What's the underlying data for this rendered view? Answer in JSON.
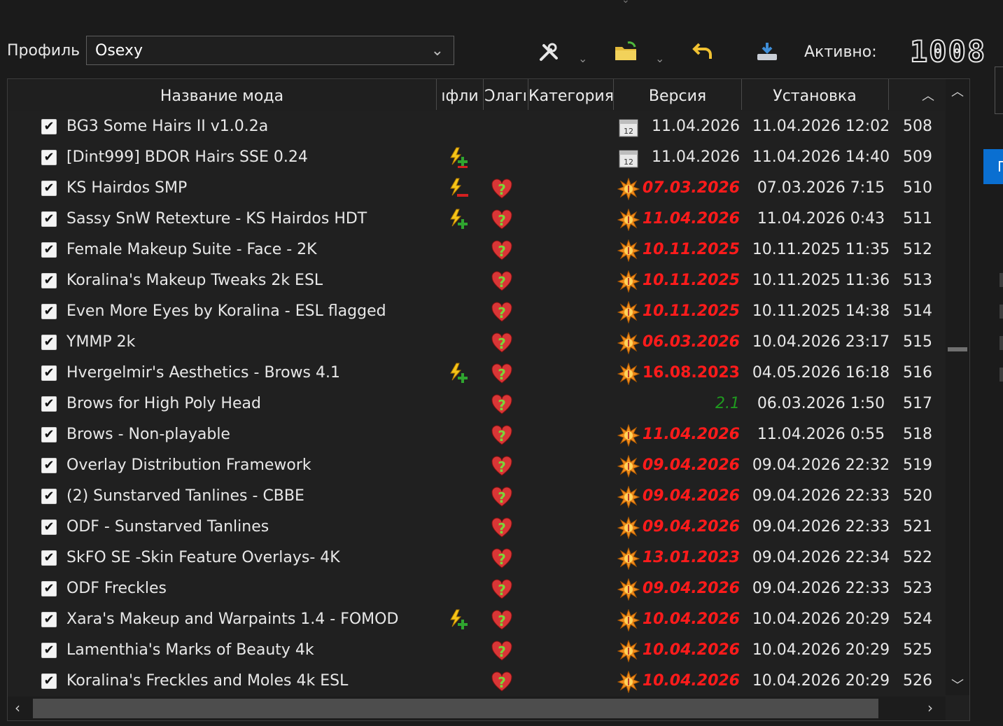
{
  "profile": {
    "label": "Профиль",
    "value": "Osexy"
  },
  "toolbar": {
    "active_label": "Активно:",
    "active_count": "1008"
  },
  "right_panel": {
    "tab_fragment": "П"
  },
  "columns": [
    "Название мода",
    "ıфли",
    "Ͻлагı",
    "Категория",
    "Версия",
    "Установка"
  ],
  "mods": [
    {
      "name": "BG3 Some Hairs II v1.0.2a",
      "conflict": "",
      "flag": "",
      "ver_icon": "calendar",
      "version": "11.04.2026",
      "version_style": "plain",
      "installed": "11.04.2026 12:02",
      "priority": "508"
    },
    {
      "name": "[Dint999] BDOR Hairs SSE 0.24",
      "conflict": "overwrite-both",
      "flag": "",
      "ver_icon": "calendar",
      "version": "11.04.2026",
      "version_style": "plain",
      "installed": "11.04.2026 14:40",
      "priority": "509"
    },
    {
      "name": "KS Hairdos SMP",
      "conflict": "overwritten",
      "flag": "heart-question",
      "ver_icon": "burst",
      "version": "07.03.2026",
      "version_style": "red",
      "installed": "07.03.2026 7:15",
      "priority": "510"
    },
    {
      "name": "Sassy SnW Retexture - KS Hairdos HDT",
      "conflict": "overwrites",
      "flag": "heart-question",
      "ver_icon": "burst",
      "version": "11.04.2026",
      "version_style": "red",
      "installed": "11.04.2026 0:43",
      "priority": "511"
    },
    {
      "name": "Female Makeup Suite - Face - 2K",
      "conflict": "",
      "flag": "heart-question",
      "ver_icon": "burst",
      "version": "10.11.2025",
      "version_style": "red",
      "installed": "10.11.2025 11:35",
      "priority": "512"
    },
    {
      "name": "Koralina's Makeup Tweaks 2k ESL",
      "conflict": "",
      "flag": "heart-question",
      "ver_icon": "burst",
      "version": "10.11.2025",
      "version_style": "red",
      "installed": "10.11.2025 11:36",
      "priority": "513"
    },
    {
      "name": "Even More Eyes by Koralina - ESL flagged",
      "conflict": "",
      "flag": "heart-question",
      "ver_icon": "burst",
      "version": "10.11.2025",
      "version_style": "red",
      "installed": "10.11.2025 14:38",
      "priority": "514"
    },
    {
      "name": "YMMP 2k",
      "conflict": "",
      "flag": "heart-question",
      "ver_icon": "burst",
      "version": "06.03.2026",
      "version_style": "red",
      "installed": "10.04.2026 23:17",
      "priority": "515"
    },
    {
      "name": "Hvergelmir's Aesthetics - Brows 4.1",
      "conflict": "overwrites",
      "flag": "heart-question",
      "ver_icon": "burst",
      "version": "16.08.2023",
      "version_style": "red-upright",
      "installed": "04.05.2026 16:18",
      "priority": "516"
    },
    {
      "name": "Brows for High Poly Head",
      "conflict": "",
      "flag": "heart-question",
      "ver_icon": "",
      "version": "2.1",
      "version_style": "green",
      "installed": "06.03.2026 1:50",
      "priority": "517"
    },
    {
      "name": "Brows - Non-playable",
      "conflict": "",
      "flag": "heart-question",
      "ver_icon": "burst",
      "version": "11.04.2026",
      "version_style": "red",
      "installed": "11.04.2026 0:55",
      "priority": "518"
    },
    {
      "name": "Overlay Distribution Framework",
      "conflict": "",
      "flag": "heart-question",
      "ver_icon": "burst",
      "version": "09.04.2026",
      "version_style": "red",
      "installed": "09.04.2026 22:32",
      "priority": "519"
    },
    {
      "name": "(2) Sunstarved Tanlines - CBBE",
      "conflict": "",
      "flag": "heart-question",
      "ver_icon": "burst",
      "version": "09.04.2026",
      "version_style": "red",
      "installed": "09.04.2026 22:33",
      "priority": "520"
    },
    {
      "name": "ODF - Sunstarved Tanlines",
      "conflict": "",
      "flag": "heart-question",
      "ver_icon": "burst",
      "version": "09.04.2026",
      "version_style": "red",
      "installed": "09.04.2026 22:33",
      "priority": "521"
    },
    {
      "name": "SkFO SE -Skin Feature Overlays- 4K",
      "conflict": "",
      "flag": "heart-question",
      "ver_icon": "burst",
      "version": "13.01.2023",
      "version_style": "red",
      "installed": "09.04.2026 22:34",
      "priority": "522"
    },
    {
      "name": "ODF Freckles",
      "conflict": "",
      "flag": "heart-question",
      "ver_icon": "burst",
      "version": "09.04.2026",
      "version_style": "red",
      "installed": "09.04.2026 22:33",
      "priority": "523"
    },
    {
      "name": "Xara's Makeup and Warpaints 1.4 - FOMOD",
      "conflict": "overwrites",
      "flag": "heart-question",
      "ver_icon": "burst",
      "version": "10.04.2026",
      "version_style": "red",
      "installed": "10.04.2026 20:29",
      "priority": "524"
    },
    {
      "name": "Lamenthia's Marks of Beauty 4k",
      "conflict": "",
      "flag": "heart-question",
      "ver_icon": "burst",
      "version": "10.04.2026",
      "version_style": "red",
      "installed": "10.04.2026 20:29",
      "priority": "525"
    },
    {
      "name": "Koralina's Freckles and Moles 4k ESL",
      "conflict": "",
      "flag": "heart-question",
      "ver_icon": "burst",
      "version": "10.04.2026",
      "version_style": "red",
      "installed": "10.04.2026 20:29",
      "priority": "526"
    }
  ],
  "colors": {
    "outdated_version": "#ff1b1b",
    "ok_version": "#1f9a1f",
    "accent": "#0a6fd1"
  }
}
